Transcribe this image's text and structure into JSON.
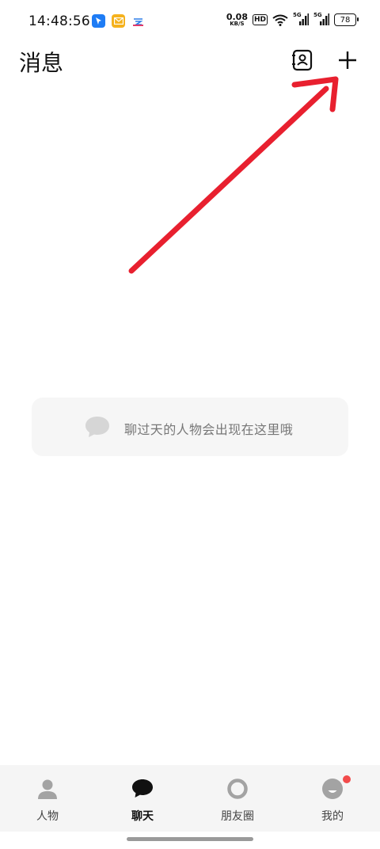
{
  "status_bar": {
    "time": "14:48:56",
    "net_speed_value": "0.08",
    "net_speed_unit": "KB/S",
    "hd_label": "HD",
    "signal1_tag": "5G",
    "signal2_tag": "5G",
    "battery": "78"
  },
  "header": {
    "title": "消息",
    "contacts_icon": "contacts-book-icon",
    "add_icon": "plus-icon"
  },
  "annotation": {
    "arrow_color": "#e8202f"
  },
  "empty_state": {
    "text": "聊过天的人物会出现在这里哦",
    "icon": "chat-bubble-icon"
  },
  "bottom_nav": {
    "items": [
      {
        "label": "人物",
        "icon": "person-icon",
        "active": false
      },
      {
        "label": "聊天",
        "icon": "chat-bubble-icon",
        "active": true
      },
      {
        "label": "朋友圈",
        "icon": "circle-ring-icon",
        "active": false
      },
      {
        "label": "我的",
        "icon": "profile-face-icon",
        "active": false
      }
    ],
    "badge_color": "#f24b4b"
  }
}
